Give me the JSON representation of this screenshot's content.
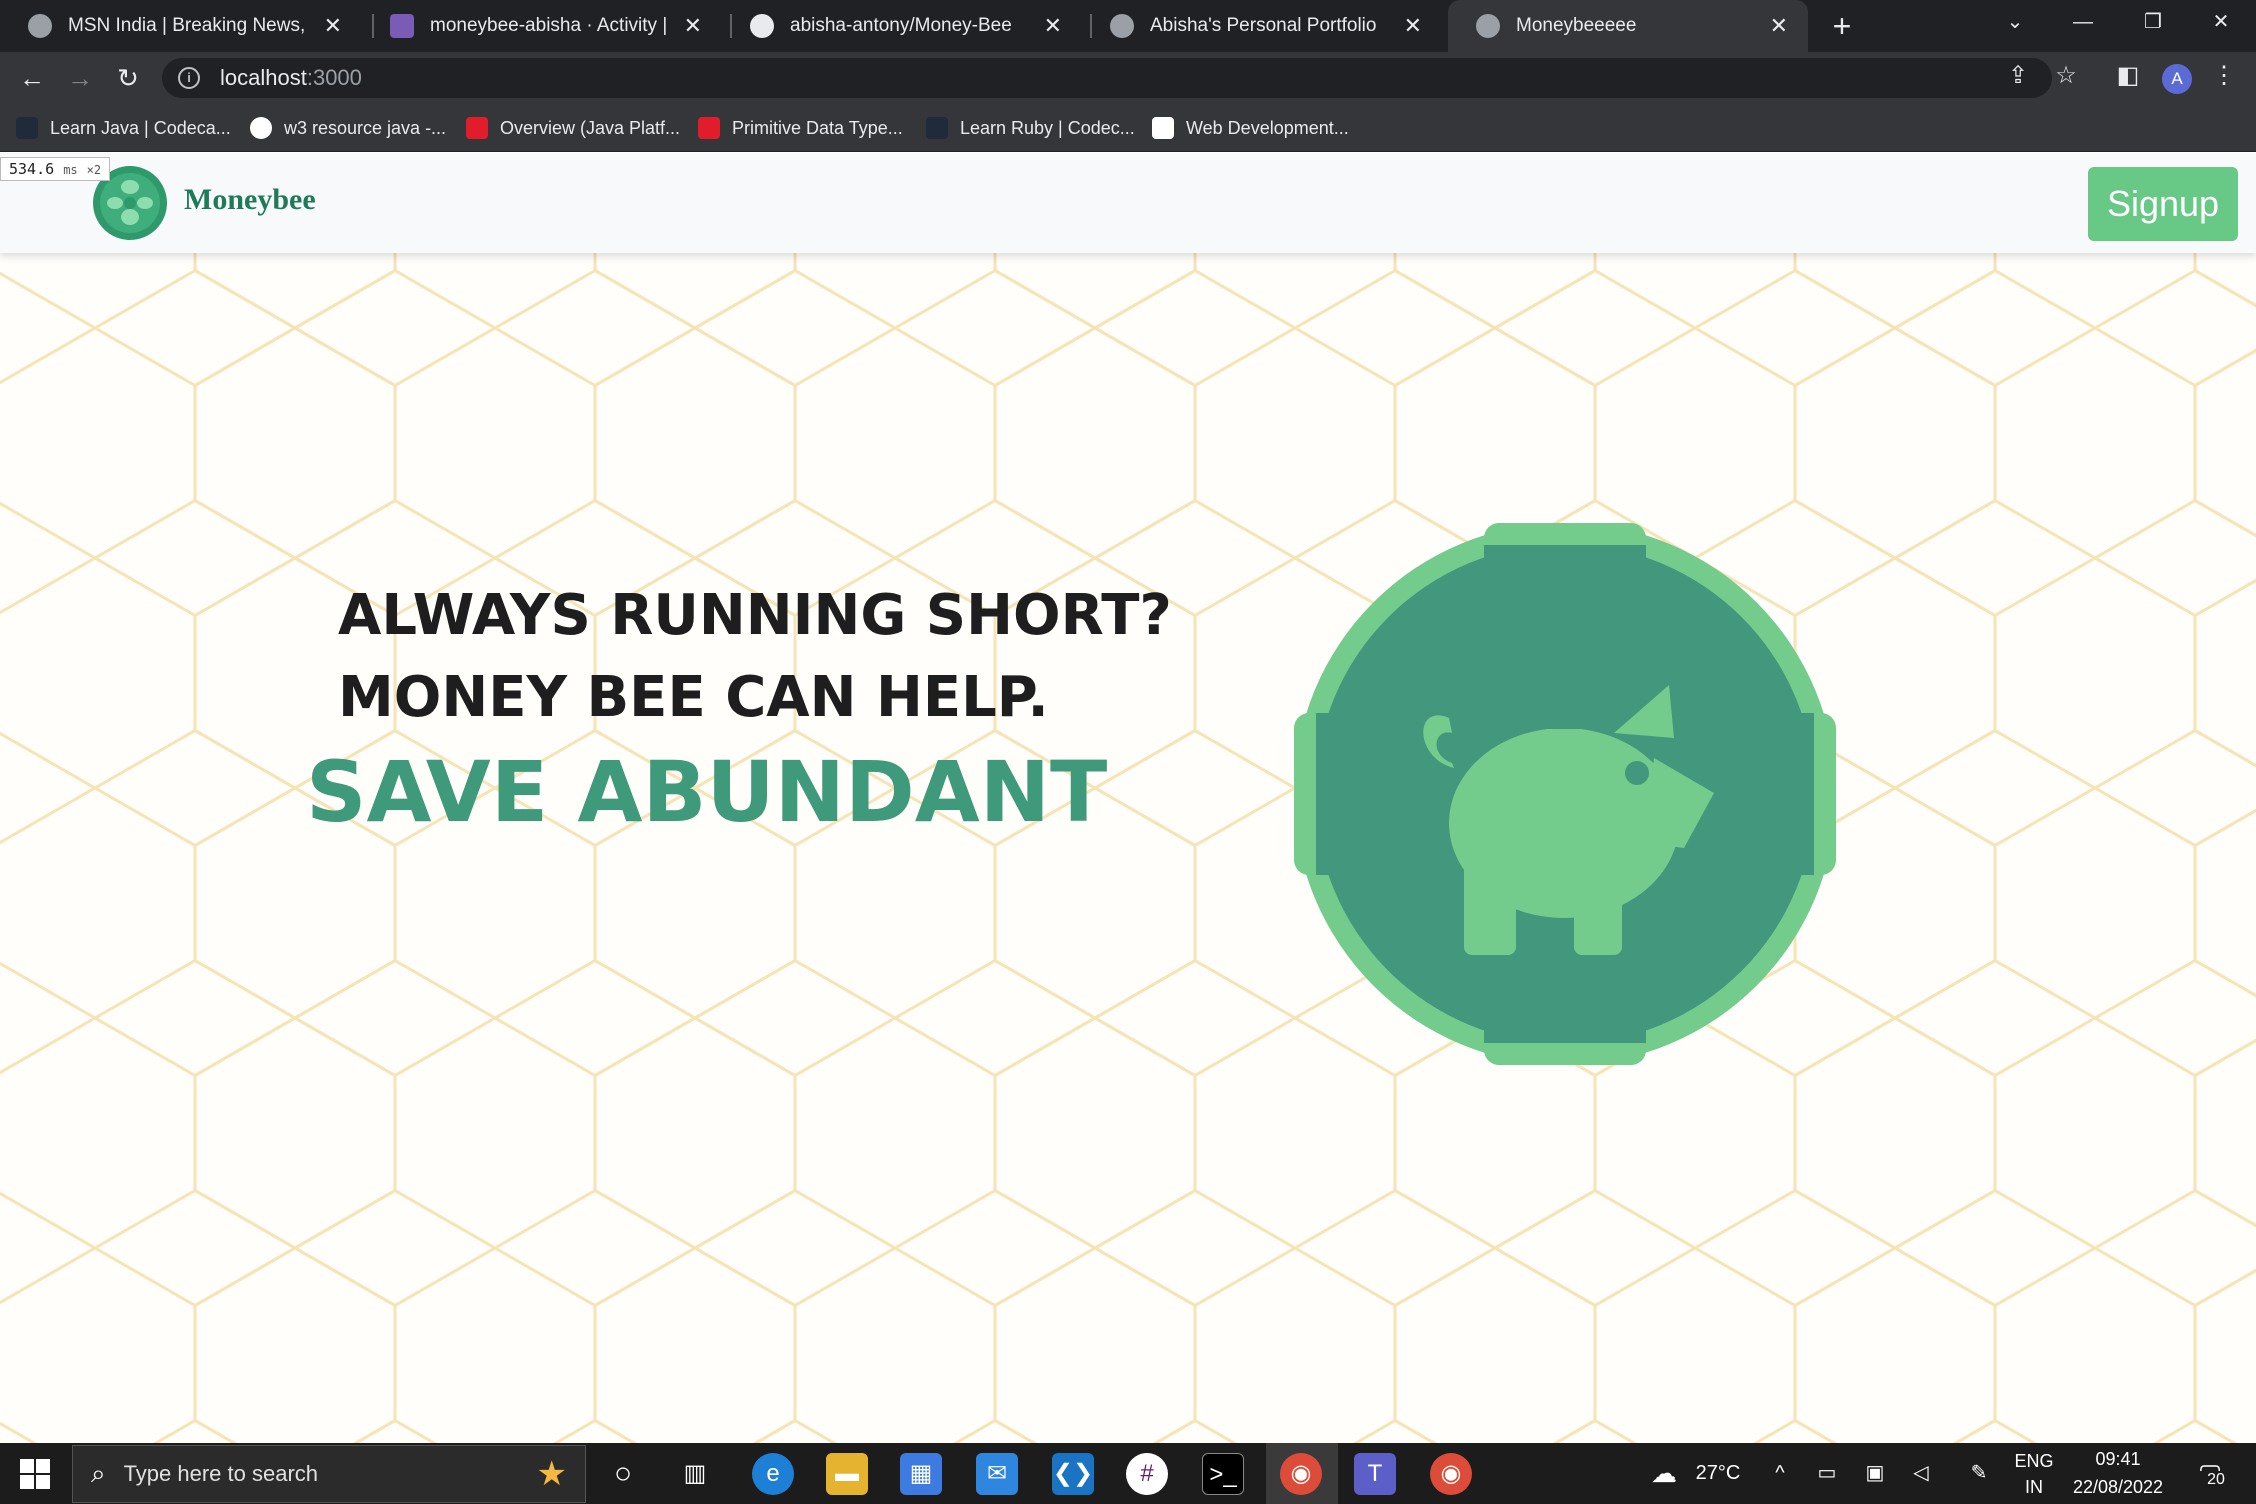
{
  "browser": {
    "tabs": [
      {
        "title": "MSN India | Breaking News, Entertainment",
        "icon": "globe-icon"
      },
      {
        "title": "moneybee-abisha · Activity | Heroku",
        "icon": "heroku-icon"
      },
      {
        "title": "abisha-antony/Money-Bee",
        "icon": "github-icon"
      },
      {
        "title": "Abisha's Personal Portfolio",
        "icon": "globe-icon"
      },
      {
        "title": "Moneybeeeee",
        "icon": "globe-icon",
        "active": true
      }
    ],
    "url_host": "localhost",
    "url_port": ":3000",
    "profile_initial": "A",
    "bookmarks": [
      {
        "label": "Learn Java | Codeca...",
        "color": "#1f2b3a"
      },
      {
        "label": "w3 resource java -...",
        "color": "#ffffff"
      },
      {
        "label": "Overview (Java Platf...",
        "color": "#e11d2b"
      },
      {
        "label": "Primitive Data Type...",
        "color": "#e11d2b"
      },
      {
        "label": "Learn Ruby | Codec...",
        "color": "#1f2b3a"
      },
      {
        "label": "Web Development...",
        "color": "#ffffff"
      }
    ]
  },
  "perf_overlay": {
    "value": "534.6",
    "unit": "ms",
    "multiplier": "×2"
  },
  "site": {
    "brand": "Moneybee",
    "signup_label": "Signup",
    "headline_line1": "ALWAYS RUNNING SHORT?",
    "headline_line2": "MONEY BEE CAN HELP.",
    "tagline": "SAVE ABUNDANT",
    "colors": {
      "accent": "#3f9a7c",
      "button": "#68c987",
      "coin_dark": "#42977d",
      "coin_light": "#74cc8c",
      "hex_line": "#f6e3b6"
    }
  },
  "taskbar": {
    "search_placeholder": "Type here to search",
    "weather": "27°C",
    "language": "ENG",
    "region": "IN",
    "time": "09:41",
    "date": "22/08/2022",
    "notifications": "20"
  }
}
